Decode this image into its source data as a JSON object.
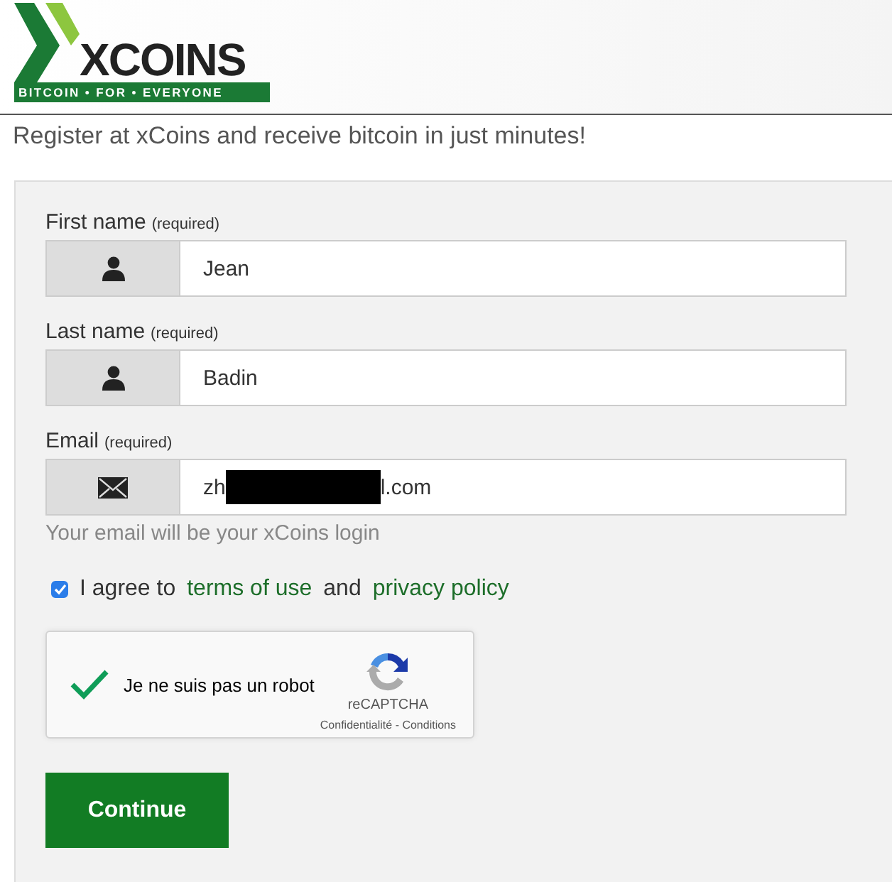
{
  "logo": {
    "name": "XCOINS",
    "tagline": "BITCOIN • FOR • EVERYONE"
  },
  "intro": "Register at xCoins and receive bitcoin in just minutes!",
  "fields": [
    {
      "label": "First name",
      "note": "(required)",
      "kind": "person",
      "value": "Jean"
    },
    {
      "label": "Last name",
      "note": "(required)",
      "kind": "person",
      "value": "Badin"
    },
    {
      "label": "Email",
      "note": "(required)",
      "kind": "email",
      "value": "zh",
      "value_end": "l.com",
      "redacted": true
    }
  ],
  "email_hint": "Your email will be your xCoins login",
  "agree": {
    "checked": true,
    "text": "I agree to",
    "link_1": "terms of use",
    "joiner": "and",
    "link_2": "privacy policy"
  },
  "captcha": {
    "checked": true,
    "label": "Je ne suis pas un robot",
    "brand": "reCAPTCHA",
    "links": "Confidentialité - Conditions"
  },
  "submit": "Continue"
}
